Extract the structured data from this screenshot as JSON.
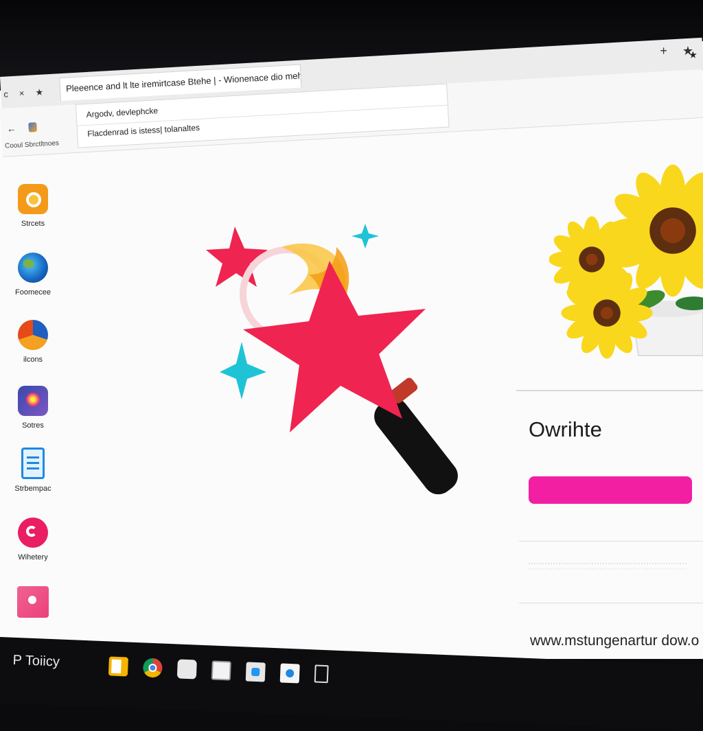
{
  "window": {
    "controls": [
      "+",
      "★"
    ]
  },
  "tabbar": {
    "nav": [
      "c",
      "×",
      "★"
    ],
    "tab_title": "Pleeence and lt lte iremirtcase Btehe |  -  Wionenace dio mehitme dtar",
    "bookmark_icon": "★"
  },
  "toolbar": {
    "left_symbol": "←",
    "caption": "Cooul Sbrctltnoes",
    "address_suggestion_1": "Argodv, devlephcke",
    "address_suggestion_2": "Flacdenrad is istess| tolanaltes"
  },
  "sidebar": {
    "items": [
      {
        "label": "Strcets",
        "icon": "store-icon"
      },
      {
        "label": "Foomecee",
        "icon": "globe-icon"
      },
      {
        "label": "ilcons",
        "icon": "pie-chart-icon"
      },
      {
        "label": "Sotres",
        "icon": "photos-icon"
      },
      {
        "label": "Strbempac",
        "icon": "notes-icon"
      },
      {
        "label": "Wihetery",
        "icon": "chat-icon"
      },
      {
        "label": "",
        "icon": "pink-app-icon"
      }
    ]
  },
  "panel": {
    "title": "Owrihte",
    "footer_url": "www.mstungenartur dow.o"
  },
  "taskbar": {
    "brand": "Toiicy",
    "brand_mark": "P"
  },
  "colors": {
    "accent_pink": "#f21fa3",
    "star_red": "#ef2450",
    "sparkle_cyan": "#1fc3d6",
    "flower_yellow": "#f9d71c"
  }
}
